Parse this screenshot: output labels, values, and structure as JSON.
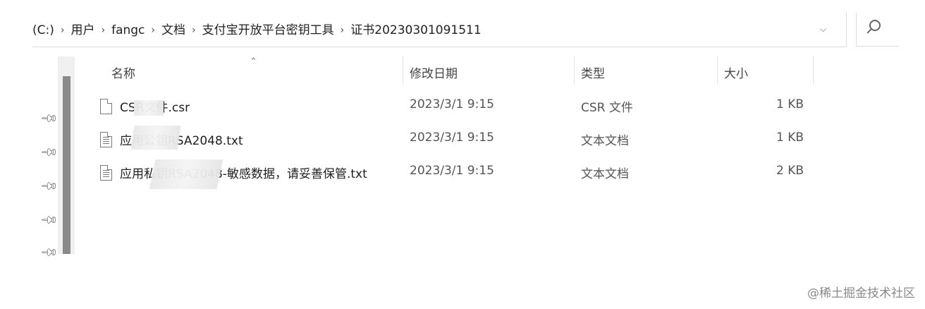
{
  "address_bar": {
    "crumbs": [
      "(C:)",
      "用户",
      "fangc",
      "文档",
      "支付宝开放平台密钥工具",
      "证书20230301091511"
    ],
    "dropdown_icon": "chevron-down-icon",
    "refresh_icon": "refresh-icon",
    "search_icon": "search-icon"
  },
  "columns": {
    "name": "名称",
    "date": "修改日期",
    "type": "类型",
    "size": "大小"
  },
  "files": [
    {
      "name": "CSR文件.csr",
      "date": "2023/3/1 9:15",
      "type": "CSR 文件",
      "size": "1 KB",
      "icon": "file-icon"
    },
    {
      "name": "应用公钥RSA2048.txt",
      "date": "2023/3/1 9:15",
      "type": "文本文档",
      "size": "1 KB",
      "icon": "text-file-icon"
    },
    {
      "name": "应用私钥RSA2048-敏感数据，请妥善保管.txt",
      "date": "2023/3/1 9:15",
      "type": "文本文档",
      "size": "2 KB",
      "icon": "text-file-icon"
    }
  ],
  "watermark": "@稀土掘金技术社区"
}
